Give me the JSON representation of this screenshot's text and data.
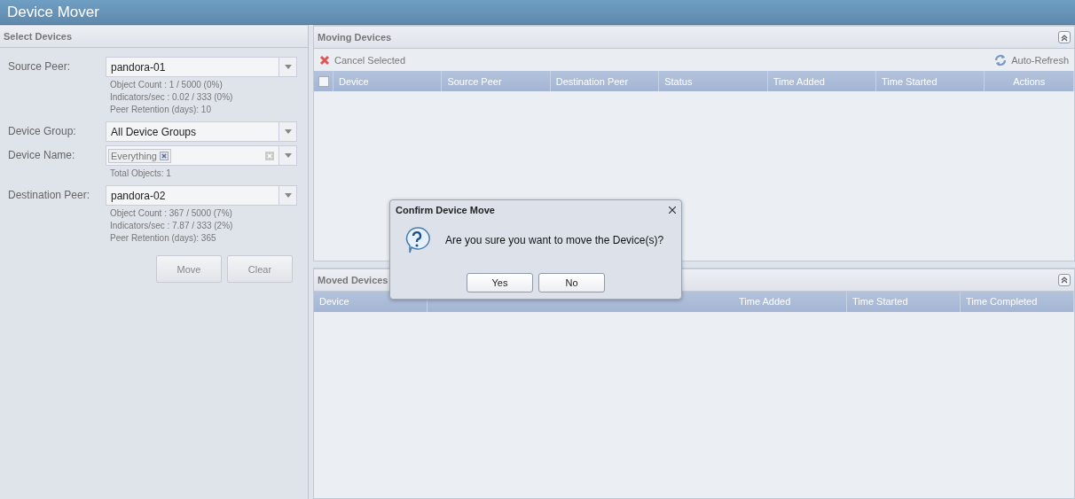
{
  "window": {
    "title": "Device Mover"
  },
  "select_panel": {
    "title": "Select Devices",
    "fields": [
      {
        "kind": "combo",
        "label": "Source Peer:",
        "value": "pandora-01",
        "info": [
          "Object Count : 1 / 5000 (0%)",
          "Indicators/sec : 0.02 / 333 (0%)",
          "Peer Retention (days): 10"
        ]
      },
      {
        "kind": "combo",
        "label": "Device Group:",
        "value": "All Device Groups"
      },
      {
        "kind": "tags",
        "label": "Device Name:",
        "tags": [
          "Everything"
        ],
        "info": [
          "Total Objects: 1"
        ]
      },
      {
        "kind": "combo",
        "label": "Destination Peer:",
        "value": "pandora-02",
        "info": [
          "Object Count : 367 / 5000 (7%)",
          "Indicators/sec : 7.87 / 333 (2%)",
          "Peer Retention (days): 365"
        ]
      }
    ],
    "buttons": [
      "Move",
      "Clear"
    ]
  },
  "moving_panel": {
    "title": "Moving Devices",
    "cancel_button": "Cancel Selected",
    "refresh_button": "Auto-Refresh",
    "select_all_checked": false,
    "columns": [
      "Device",
      "Source Peer",
      "Destination Peer",
      "Status",
      "Time Added",
      "Time Started",
      "Actions"
    ]
  },
  "moved_panel": {
    "title": "Moved Devices",
    "columns": [
      "Device",
      "Time Added",
      "Time Started",
      "Time Completed"
    ]
  },
  "dialog": {
    "title": "Confirm Device Move",
    "message": "Are you sure you want to move the Device(s)?",
    "buttons": [
      "Yes",
      "No"
    ]
  }
}
